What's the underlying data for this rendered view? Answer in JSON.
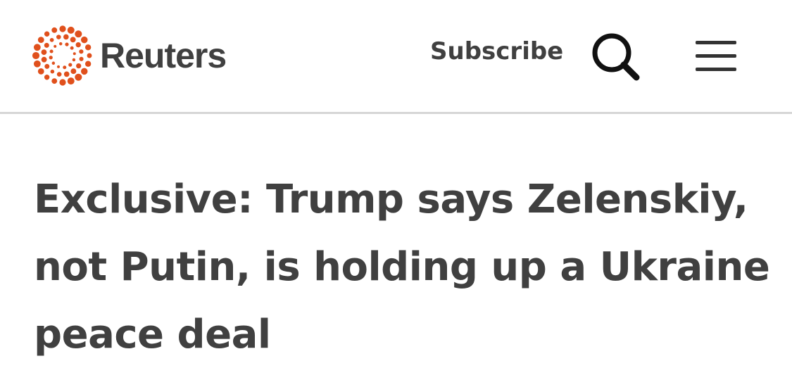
{
  "header": {
    "brand": "Reuters",
    "subscribe_label": "Subscribe",
    "search_icon": "search-icon",
    "menu_icon": "hamburger-menu-icon",
    "logo_color": "#ff8000"
  },
  "article": {
    "headline": "Exclusive: Trump says Zelenskiy, not Putin, is holding up a Ukraine peace deal"
  },
  "colors": {
    "text": "#404040",
    "divider": "#d6d6d6",
    "logo_orange": "#e8591a"
  }
}
